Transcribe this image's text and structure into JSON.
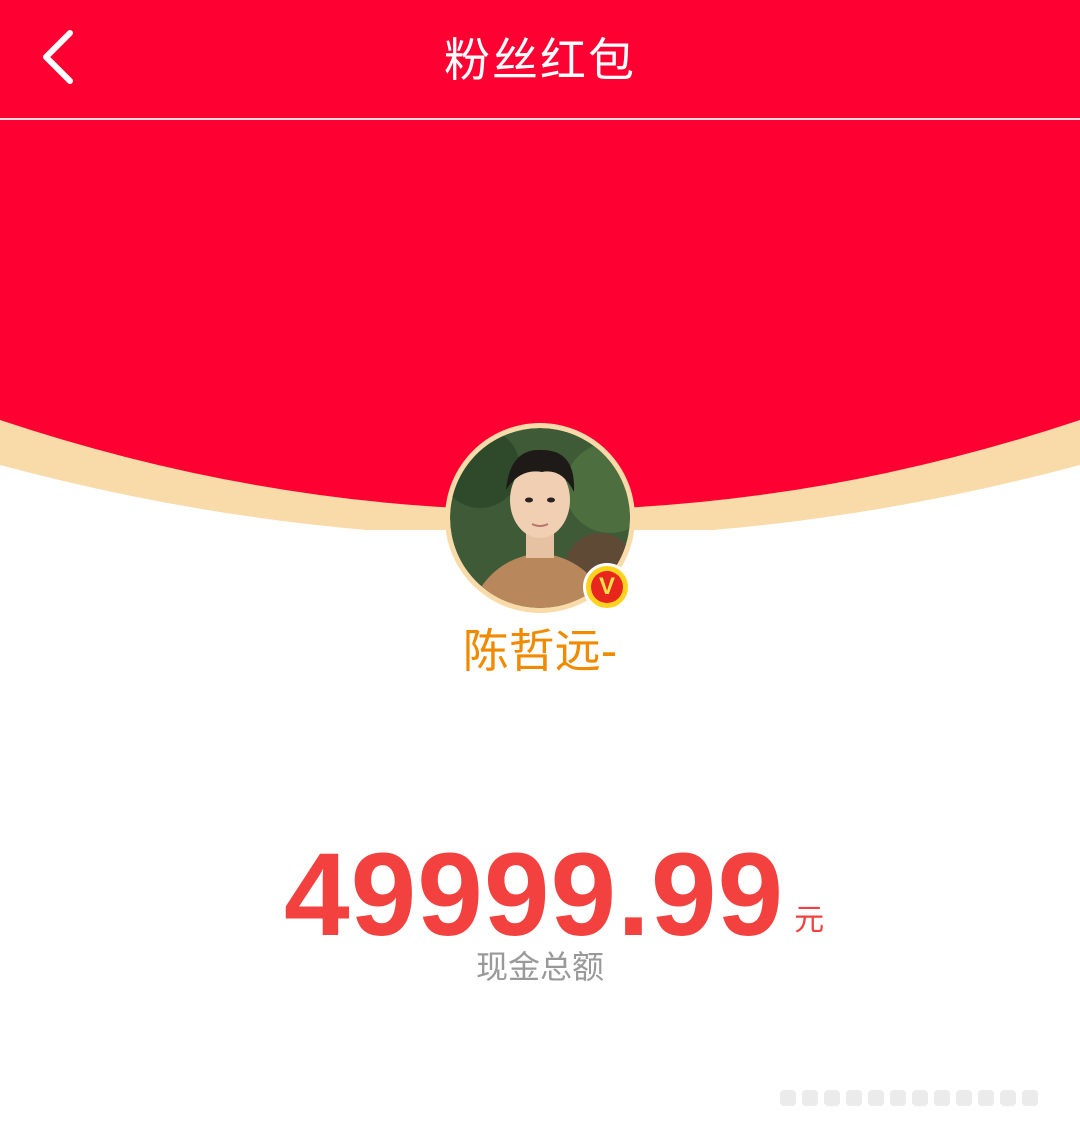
{
  "header": {
    "title": "粉丝红包",
    "back_icon": "chevron-left-icon"
  },
  "colors": {
    "header_bg": "#ff0033",
    "envelope_red": "#ff0033",
    "envelope_edge": "#f8dba8",
    "name_color": "#f08a00",
    "amount_color": "#f2413f",
    "caption_color": "#999999"
  },
  "sender": {
    "name": "陈哲远-",
    "verified_badge_text": "V"
  },
  "amount": {
    "value": "49999.99",
    "unit": "元",
    "caption": "现金总额"
  }
}
